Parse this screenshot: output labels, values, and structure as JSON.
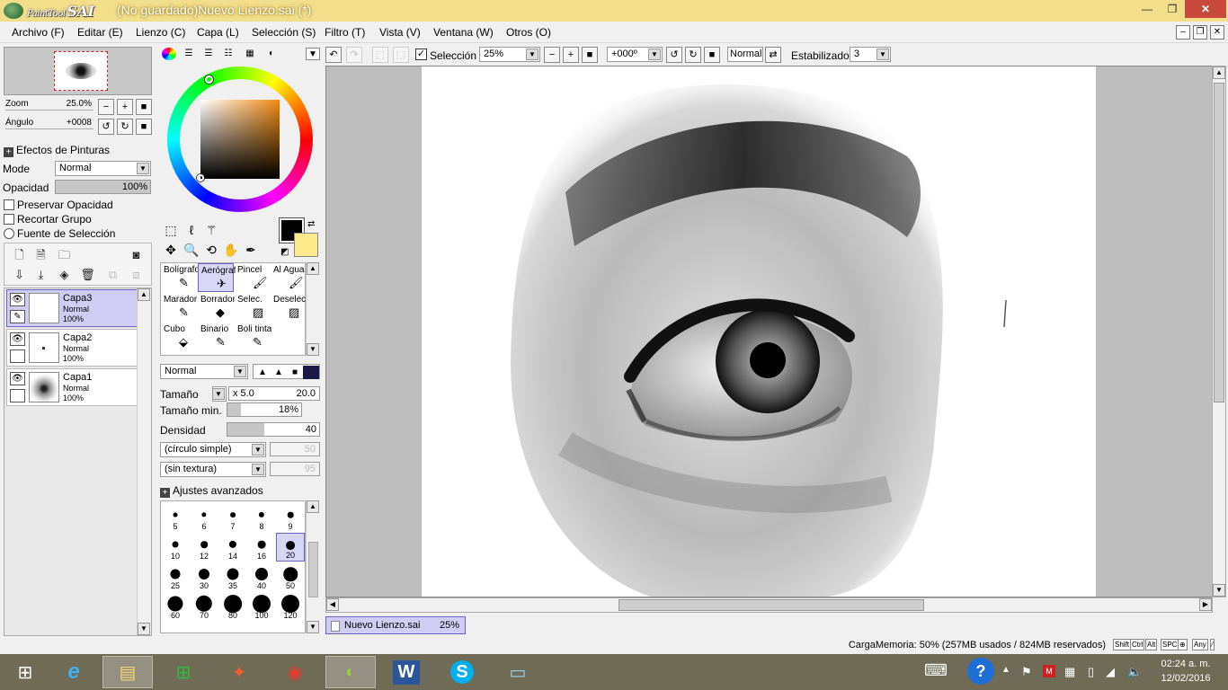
{
  "titlebar": {
    "logo_small": "PaintTool",
    "logo_big": "SAI",
    "title": "(No guardado)Nuevo Lienzo.sai (*)",
    "min": "—",
    "max": "❐",
    "close": "✕"
  },
  "menu": [
    "Archivo (F)",
    "Editar (E)",
    "Lienzo (C)",
    "Capa (L)",
    "Selección (S)",
    "Filtro (T)",
    "Vista (V)",
    "Ventana (W)",
    "Otros (O)"
  ],
  "navigator": {
    "zoom_label": "Zoom",
    "zoom_value": "25.0%",
    "angle_label": "Ángulo",
    "angle_value": "+0008"
  },
  "layer_panel": {
    "effects_label": "Efectos de Pinturas",
    "mode_label": "Mode",
    "mode_value": "Normal",
    "opacity_label": "Opacidad",
    "opacity_value": "100%",
    "opacity_fraction": 1.0,
    "preserve_opacity": "Preservar Opacidad",
    "clip_group": "Recortar Grupo",
    "selection_source": "Fuente de Selección",
    "layers": [
      {
        "name": "Capa3",
        "mode": "Normal",
        "opacity": "100%",
        "selected": true
      },
      {
        "name": "Capa2",
        "mode": "Normal",
        "opacity": "100%",
        "selected": false
      },
      {
        "name": "Capa1",
        "mode": "Normal",
        "opacity": "100%",
        "selected": false
      }
    ]
  },
  "brushes": [
    {
      "name": "Bolígrafo",
      "icon": "✎"
    },
    {
      "name": "Aerógrafo",
      "icon": "✈"
    },
    {
      "name": "Pincel",
      "icon": "🖌"
    },
    {
      "name": "Al Agua",
      "icon": "🖌"
    },
    {
      "name": "Marador",
      "icon": "✎"
    },
    {
      "name": "Borrador",
      "icon": "◆"
    },
    {
      "name": "Selec.",
      "icon": "▨"
    },
    {
      "name": "Deselec.",
      "icon": "▨"
    },
    {
      "name": "Cubo",
      "icon": "⬙"
    },
    {
      "name": "Binario",
      "icon": "✎"
    },
    {
      "name": "Boli tinta",
      "icon": "✎"
    }
  ],
  "brush_settings": {
    "blend_mode": "Normal",
    "size_label": "Tamaño",
    "size_mult": "x 5.0",
    "size_value": "20.0",
    "min_size_label": "Tamaño min.",
    "min_size_value": "18%",
    "min_size_fraction": 0.18,
    "density_label": "Densidad",
    "density_value": "40",
    "density_fraction": 0.4,
    "shape": "(círculo simple)",
    "shape_value": "50",
    "texture": "(sin textura)",
    "texture_value": "95",
    "advanced_label": "Ajustes avanzados"
  },
  "brush_sizes": [
    "5",
    "6",
    "7",
    "8",
    "9",
    "10",
    "12",
    "14",
    "16",
    "20",
    "25",
    "30",
    "35",
    "40",
    "50",
    "60",
    "70",
    "80",
    "100",
    "120"
  ],
  "selected_brush_size": "20",
  "canvas_toolbar": {
    "selection_label": "Selección",
    "zoom": "25%",
    "angle": "+000º",
    "blend": "Normal",
    "stabilizer_label": "Estabilizador",
    "stabilizer_value": "3"
  },
  "doc_tab": {
    "name": "Nuevo Lienzo.sai",
    "zoom": "25%"
  },
  "status": {
    "memory": "CargaMemoria: 50% (257MB usados / 824MB reservados)",
    "keys": [
      "Shift",
      "Ctrl",
      "Alt",
      "SPC",
      "⊕",
      "Any",
      "⁄"
    ]
  },
  "taskbar": {
    "apps": [
      {
        "name": "start",
        "icon": "⊞"
      },
      {
        "name": "internet-explorer",
        "icon": "e"
      },
      {
        "name": "file-explorer",
        "icon": "▤"
      },
      {
        "name": "store",
        "icon": "⊞"
      },
      {
        "name": "paint-app",
        "icon": "✦"
      },
      {
        "name": "chrome",
        "icon": "◉"
      },
      {
        "name": "paint-tool-sai",
        "icon": "◐"
      },
      {
        "name": "word",
        "icon": "W"
      },
      {
        "name": "skype",
        "icon": "S"
      },
      {
        "name": "photos",
        "icon": "▭"
      }
    ],
    "time": "02:24 a. m.",
    "date": "12/02/2016"
  },
  "colors": {
    "title_bg": "#f2dd8a",
    "primary": "#000000",
    "secondary": "#fdea8c",
    "selected": "#cfcdf3"
  }
}
